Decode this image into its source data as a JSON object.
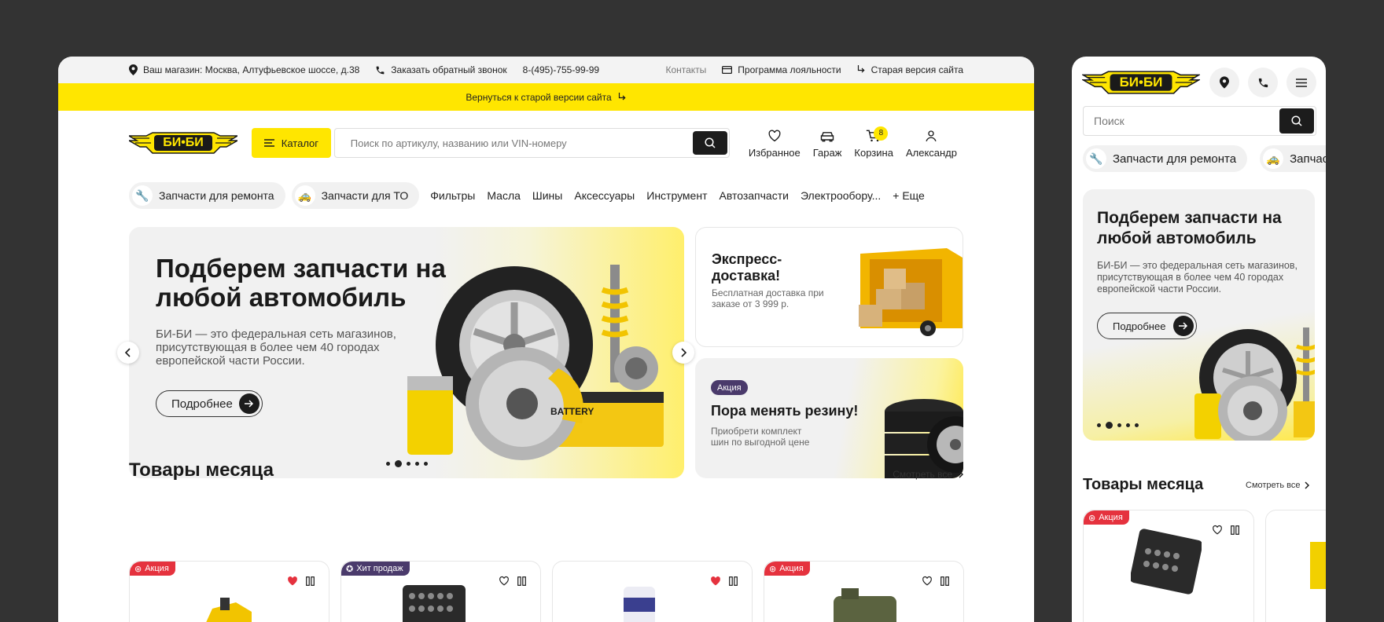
{
  "topbar": {
    "store": "Ваш магазин: Москва, Алтуфьевское шоссе, д.38",
    "callback": "Заказать обратный звонок",
    "phone": "8-(495)-755-99-99",
    "contacts": "Контакты",
    "loyalty": "Программа лояльности",
    "old_site": "Старая версия сайта"
  },
  "notice": {
    "text": "Вернуться к старой версии сайта"
  },
  "logo": {
    "text": "БИ•БИ"
  },
  "header": {
    "catalog_label": "Каталог",
    "search_placeholder": "Поиск по артикулу, названию или VIN-номеру",
    "favorites": "Избранное",
    "garage": "Гараж",
    "cart": "Корзина",
    "cart_count": "8",
    "account": "Александр"
  },
  "nav": {
    "pill_repair": "Запчасти для ремонта",
    "pill_to": "Запчасти для ТО",
    "links": [
      "Фильтры",
      "Масла",
      "Шины",
      "Аксессуары",
      "Инструмент",
      "Автозапчасти",
      "Электрообору...",
      "+ Еще"
    ]
  },
  "hero": {
    "title": "Подберем запчасти на любой автомобиль",
    "text": "БИ-БИ — это федеральная сеть магазинов, присутствующая в более чем 40 городах европейской части России.",
    "button": "Подробнее",
    "battery_label": "BATTERY"
  },
  "promo_delivery": {
    "title": "Экспресс-доставка!",
    "text": "Бесплатная доставка при заказе от 3 999 р."
  },
  "promo_tires": {
    "tag": "Акция",
    "title": "Пора менять резину!",
    "text": "Приобрети комплект шин по выгодной цене"
  },
  "products_section": {
    "title": "Товары месяца",
    "see_all": "Смотреть все"
  },
  "products": [
    {
      "tag": "Акция",
      "tag_kind": "red",
      "favorite": true
    },
    {
      "tag": "Хит продаж",
      "tag_kind": "purple",
      "favorite": false
    },
    {
      "tag": "",
      "tag_kind": "none",
      "favorite": true
    },
    {
      "tag": "Акция",
      "tag_kind": "red",
      "favorite": false
    }
  ],
  "mobile": {
    "search_placeholder": "Поиск",
    "pill_repair": "Запчасти для ремонта",
    "pill_to_partial": "Запчаст",
    "hero_title": "Подберем запчасти на любой автомобиль",
    "hero_text": "БИ-БИ — это федеральная сеть магазинов, присутствующая в более чем 40 городах европейской части России.",
    "hero_button": "Подробнее",
    "section_title": "Товары месяца",
    "see_all": "Смотреть все",
    "product_tag": "Акция"
  },
  "colors": {
    "accent": "#FFE600",
    "dark": "#1C1C1C",
    "sale": "#E5323E",
    "hit": "#4A3A6B",
    "background": "#333333"
  }
}
